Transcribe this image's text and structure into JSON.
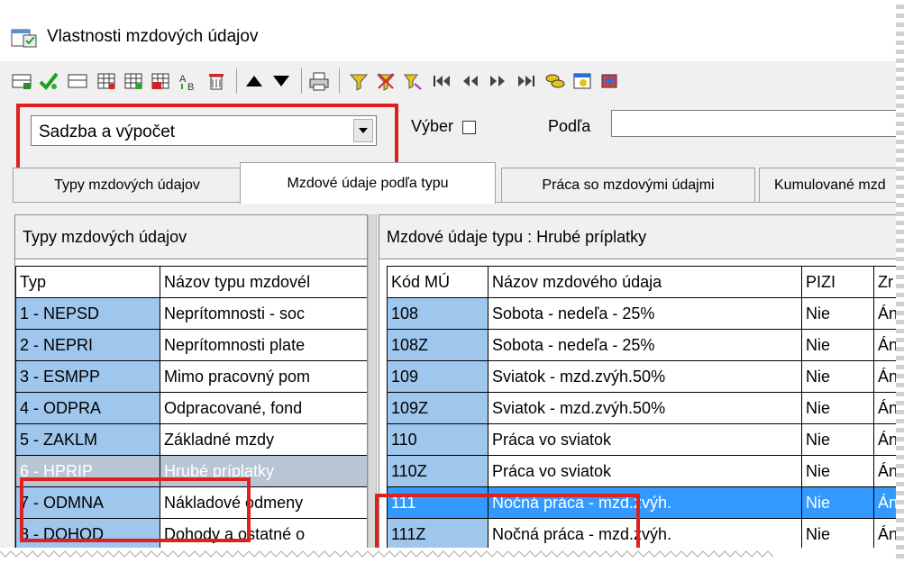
{
  "window": {
    "title": "Vlastnosti mzdových údajov"
  },
  "toolbar": {
    "icons": [
      "table-add-icon",
      "check-icon",
      "table-remove-icon",
      "grid-icon",
      "grid-add-icon",
      "grid-edit-icon",
      "sort-az-icon",
      "delete-icon",
      "arrow-up-icon",
      "arrow-down-icon",
      "print-icon",
      "filter-icon",
      "clear-filter-icon",
      "filter-alt-icon",
      "first-record-icon",
      "prev-record-icon",
      "next-record-icon",
      "last-record-icon",
      "coins-icon",
      "calendar-icon",
      "tools-icon"
    ]
  },
  "filter": {
    "view_select_value": "Sadzba a výpočet",
    "selection_label": "Výber",
    "selection_checked": false,
    "by_label": "Podľa",
    "by_value": ""
  },
  "tabs": [
    {
      "label": "Typy mzdových údajov",
      "active": false
    },
    {
      "label": "Mzdové údaje podľa typu",
      "active": true
    },
    {
      "label": "Práca so mzdovými údajmi",
      "active": false
    },
    {
      "label": "Kumulované mzd",
      "active": false
    }
  ],
  "left_panel": {
    "title": "Typy mzdových údajov",
    "columns": [
      "Typ",
      "Názov typu mzdovél"
    ],
    "rows": [
      {
        "typ": "1 - NEPSD",
        "nazov": "Neprítomnosti - soc"
      },
      {
        "typ": "2 - NEPRI",
        "nazov": "Neprítomnosti plate"
      },
      {
        "typ": "3 - ESMPP",
        "nazov": "Mimo pracovný pom"
      },
      {
        "typ": "4 - ODPRA",
        "nazov": "Odpracované, fond"
      },
      {
        "typ": "5 - ZAKLM",
        "nazov": "Základné mzdy"
      },
      {
        "typ": "6 - HPRIP",
        "nazov": "Hrubé príplatky"
      },
      {
        "typ": "7 - ODMNA",
        "nazov": "Nákladové odmeny"
      },
      {
        "typ": "8 - DOHOD",
        "nazov": "Dohody a ostatné o"
      }
    ],
    "selected_index": 5
  },
  "right_panel": {
    "title": "Mzdové údaje typu : Hrubé príplatky",
    "columns": [
      "Kód MÚ",
      "Názov mzdového údaja",
      "PIZI",
      "Zr"
    ],
    "rows": [
      {
        "kod": "108",
        "nazov": "Sobota - nedeľa - 25%",
        "pizi": "Nie",
        "zr": "Án"
      },
      {
        "kod": "108Z",
        "nazov": "Sobota - nedeľa - 25%",
        "pizi": "Nie",
        "zr": "Án"
      },
      {
        "kod": "109",
        "nazov": "Sviatok - mzd.zvýh.50%",
        "pizi": "Nie",
        "zr": "Án"
      },
      {
        "kod": "109Z",
        "nazov": "Sviatok - mzd.zvýh.50%",
        "pizi": "Nie",
        "zr": "Án"
      },
      {
        "kod": "110",
        "nazov": "Práca vo sviatok",
        "pizi": "Nie",
        "zr": "Án"
      },
      {
        "kod": "110Z",
        "nazov": "Práca vo sviatok",
        "pizi": "Nie",
        "zr": "Án"
      },
      {
        "kod": "111",
        "nazov": "Nočná práca - mzd.zvýh.",
        "pizi": "Nie",
        "zr": "Án"
      },
      {
        "kod": "111Z",
        "nazov": "Nočná práca - mzd.zvýh.",
        "pizi": "Nie",
        "zr": "Án"
      }
    ],
    "selected_index": 6
  },
  "colors": {
    "highlight_red": "#e02020",
    "selection_blue": "#3399ff",
    "key_column_blue": "#9fc6ec"
  }
}
